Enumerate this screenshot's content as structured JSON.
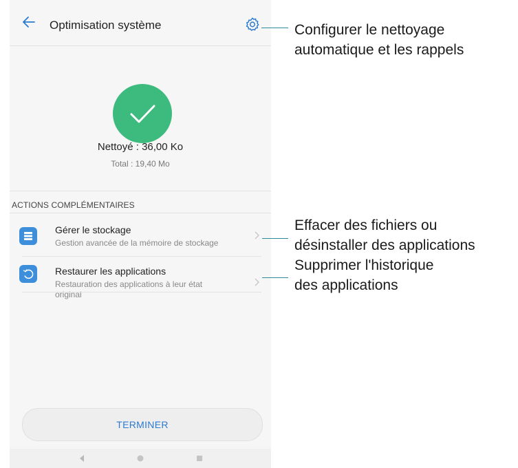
{
  "header": {
    "title": "Optimisation système",
    "back_icon": "arrow-left-icon",
    "settings_icon": "gear-icon"
  },
  "status": {
    "cleaned": "Nettoyé : 36,00 Ko",
    "total": "Total : 19,40  Mo",
    "icon": "checkmark-icon",
    "color": "#3dbb7e"
  },
  "actions": {
    "section_title": "ACTIONS COMPLÉMENTAIRES",
    "items": [
      {
        "title": "Gérer le stockage",
        "subtitle": "Gestion avancée de la mémoire de stockage",
        "icon": "storage-icon"
      },
      {
        "title": "Restaurer les applications",
        "subtitle_line1": "Restauration des applications à leur état",
        "subtitle_line2": "original",
        "icon": "restore-icon"
      }
    ]
  },
  "footer": {
    "done_label": "TERMINER"
  },
  "annotations": {
    "settings": [
      "Configurer le nettoyage",
      "automatique et les rappels"
    ],
    "storage": [
      "Effacer des fichiers ou",
      "désinstaller des applications"
    ],
    "restore": [
      "Supprimer l'historique",
      "des applications"
    ]
  },
  "colors": {
    "accent": "#2a7bd0",
    "icon_blue": "#3d8fdc",
    "leader_line": "#2a8a9a"
  }
}
